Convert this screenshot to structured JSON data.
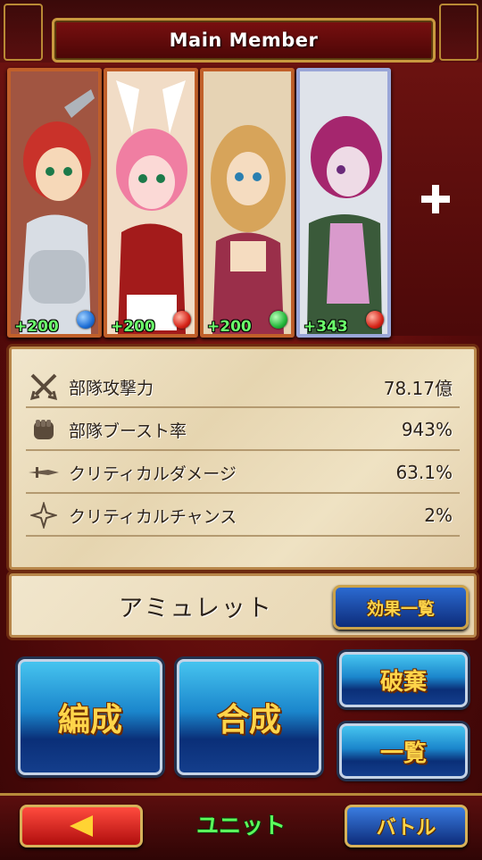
{
  "header": {
    "title": "Main Member"
  },
  "party": {
    "members": [
      {
        "bonus": "+200",
        "element_color": "#1e6fd6",
        "theme": [
          "#f6d8b8",
          "#c9322a",
          "#d8dde4"
        ]
      },
      {
        "bonus": "+200",
        "element_color": "#d62418",
        "theme": [
          "#fbd9d6",
          "#f07ea2",
          "#a31b1b"
        ]
      },
      {
        "bonus": "+200",
        "element_color": "#23b83a",
        "theme": [
          "#f5dcc0",
          "#d7a45a",
          "#9a2f4a"
        ]
      },
      {
        "bonus": "+343",
        "element_color": "#d62418",
        "theme": [
          "#eedbe6",
          "#a5266e",
          "#3a5a3a"
        ]
      }
    ],
    "add_slot_icon": "plus-icon"
  },
  "stats": [
    {
      "icon": "crossed-swords-icon",
      "label": "部隊攻撃力",
      "value": "78.17億"
    },
    {
      "icon": "fist-icon",
      "label": "部隊ブースト率",
      "value": "943%"
    },
    {
      "icon": "dagger-icon",
      "label": "クリティカルダメージ",
      "value": "63.1%"
    },
    {
      "icon": "sparkle-icon",
      "label": "クリティカルチャンス",
      "value": "2%"
    }
  ],
  "amulet": {
    "label": "アミュレット",
    "effects_button": "効果一覧"
  },
  "actions": {
    "formation": "編成",
    "fusion": "合成",
    "discard": "破棄",
    "list": "一覧"
  },
  "nav": {
    "back_icon": "left-arrow-icon",
    "title": "ユニット",
    "battle": "バトル"
  }
}
